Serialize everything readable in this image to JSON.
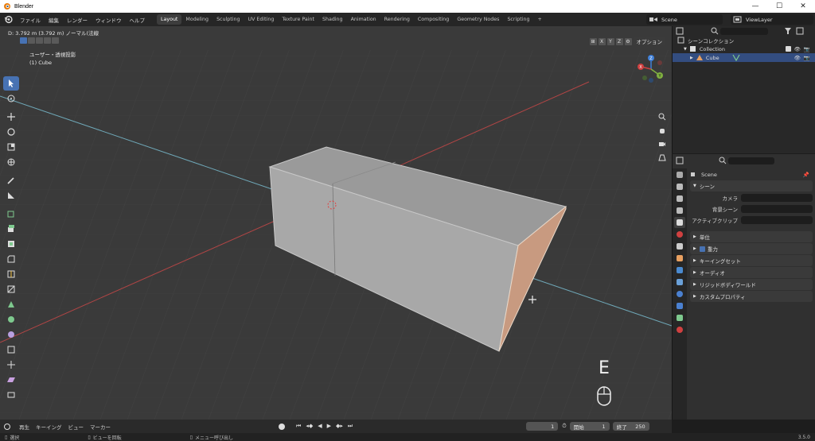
{
  "window": {
    "title": "Blender"
  },
  "menu": {
    "items": [
      "ファイル",
      "編集",
      "レンダー",
      "ウィンドウ",
      "ヘルプ"
    ]
  },
  "workspaces": [
    "Layout",
    "Modeling",
    "Sculpting",
    "UV Editing",
    "Texture Paint",
    "Shading",
    "Animation",
    "Rendering",
    "Compositing",
    "Geometry Nodes",
    "Scripting",
    "+"
  ],
  "topright": {
    "scene": "Scene",
    "view_layer": "ViewLayer"
  },
  "viewport": {
    "status": "D: 3.792 m (3.792 m) ノーマル(法線",
    "view_name": "ユーザー・透視投影",
    "object_name": "(1) Cube",
    "axis_buttons": [
      "X",
      "Y",
      "Z"
    ],
    "options_label": "オプション",
    "key_overlay": "E",
    "gizmo": {
      "x": "X",
      "y": "Y",
      "z": "Z"
    }
  },
  "outliner": {
    "scene_collection": "シーンコレクション",
    "collection": "Collection",
    "object": "Cube"
  },
  "properties": {
    "scene_name": "Scene",
    "panel_scene": "シーン",
    "camera_label": "カメラ",
    "background_label": "背景シーン",
    "clip_label": "アクティブクリップ",
    "panels": [
      "単位",
      "重力",
      "キーイングセット",
      "オーディオ",
      "リジッドボディワールド",
      "カスタムプロパティ"
    ]
  },
  "timeline": {
    "playback": "再生",
    "keying": "キーイング",
    "view": "ビュー",
    "marker": "マーカー",
    "current_frame": "1",
    "start_label": "開始",
    "start": "1",
    "end_label": "終了",
    "end": "250"
  },
  "status": {
    "select": "選択",
    "rotate": "ビューを回転",
    "menu": "メニュー呼び出し",
    "version": "3.5.0"
  },
  "colors": {
    "accent": "#4772b3",
    "x_axis": "#d04040",
    "y_axis": "#80b040",
    "z_axis": "#4080d8"
  }
}
